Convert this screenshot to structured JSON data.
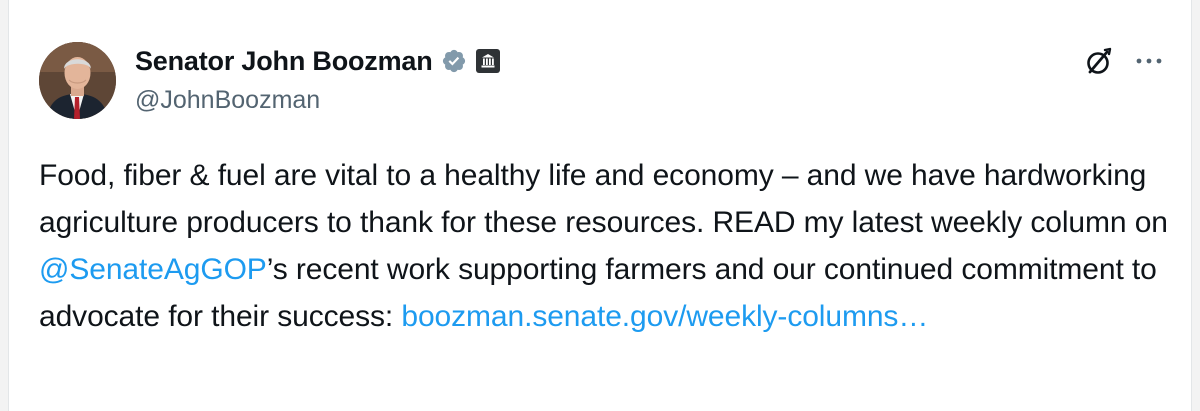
{
  "author": {
    "display_name": "Senator John Boozman",
    "handle": "@JohnBoozman",
    "avatar_icon": "portrait-avatar",
    "verified_icon": "verified-badge-icon",
    "affiliation_icon": "government-building-icon"
  },
  "actions": {
    "grok_icon": "grok-icon",
    "more_icon": "more-options-icon"
  },
  "tweet": {
    "text_part1": "Food, fiber & fuel are vital to a healthy life and economy – and we have hardworking agriculture producers to thank for these resources. READ my latest weekly column on ",
    "mention": "@SenateAgGOP",
    "text_part2": "’s recent work supporting farmers and our continued commitment to advocate for their success: ",
    "link": "boozman.senate.gov/weekly-columns…"
  },
  "colors": {
    "text": "#0f1419",
    "secondary": "#536471",
    "link": "#1d9bf0",
    "verified_gray": "#829aab"
  }
}
